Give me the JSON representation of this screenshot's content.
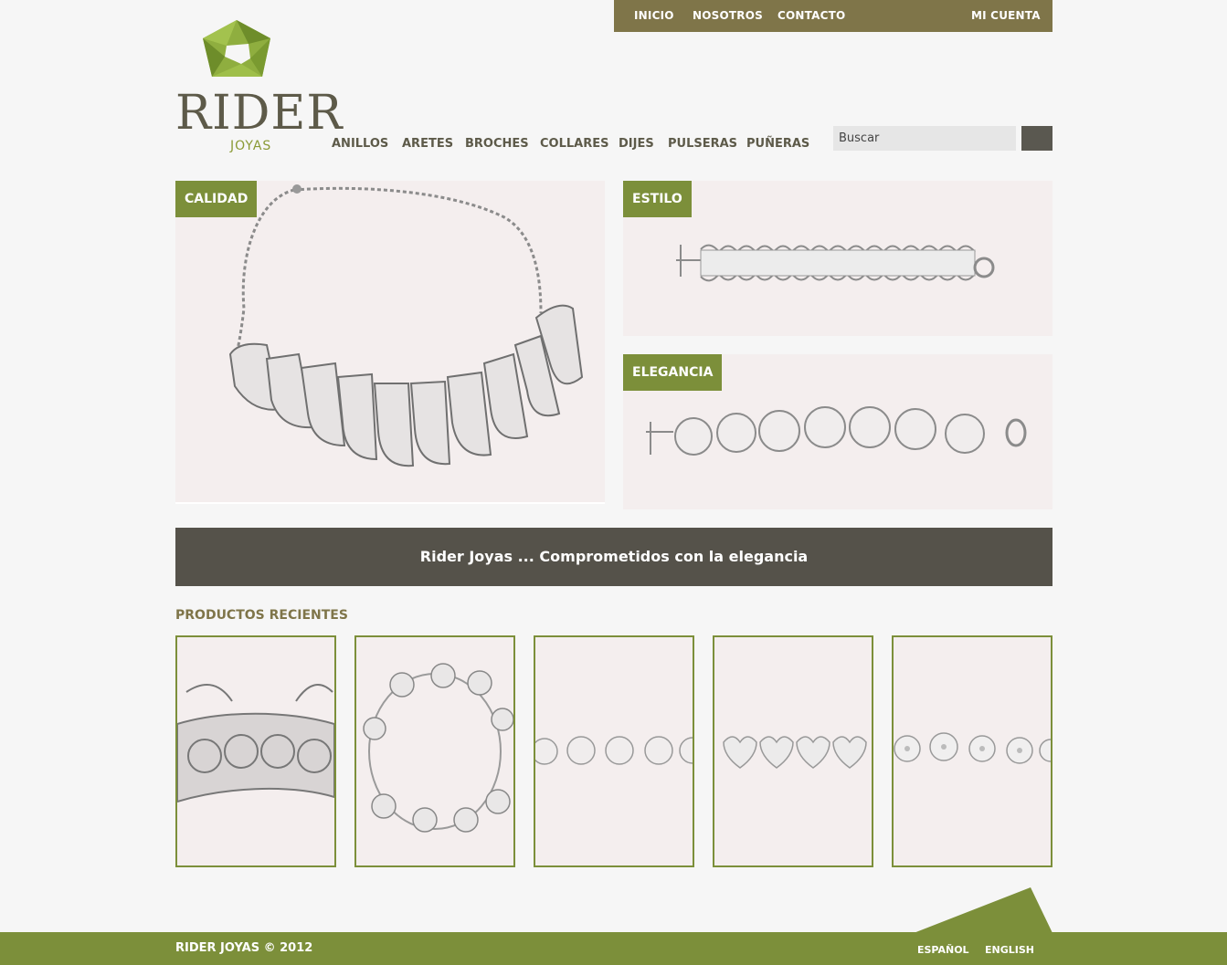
{
  "top_nav": {
    "items": [
      "INICIO",
      "NOSOTROS",
      "CONTACTO"
    ],
    "account": "MI CUENTA"
  },
  "logo": {
    "word": "RIDER",
    "sub": "JOYAS"
  },
  "category_nav": [
    "ANILLOS",
    "ARETES",
    "BROCHES",
    "COLLARES",
    "DIJES",
    "PULSERAS",
    "PUÑERAS"
  ],
  "search": {
    "placeholder": "Buscar"
  },
  "hero": {
    "main_label": "CALIDAD",
    "top_right_label": "ESTILO",
    "bottom_right_label": "ELEGANCIA"
  },
  "banner": {
    "text": "Rider Joyas ... Comprometidos con la elegancia"
  },
  "recent": {
    "title": "PRODUCTOS RECIENTES"
  },
  "footer": {
    "copyright": "RIDER JOYAS © 2012",
    "languages": [
      "ESPAÑOL",
      "ENGLISH"
    ]
  },
  "colors": {
    "olive_dark": "#7f7549",
    "green_accent": "#7c8f3a",
    "banner_gray": "#55524a",
    "text_dark": "#5d5a49"
  }
}
